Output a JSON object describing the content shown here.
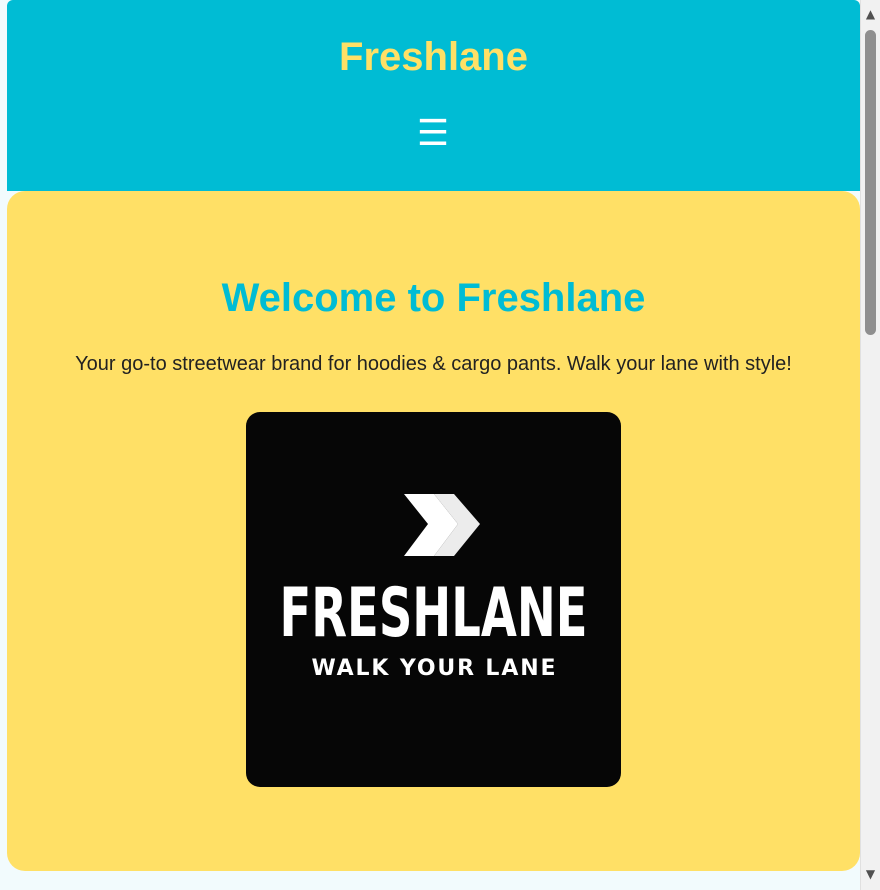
{
  "header": {
    "site_title": "Freshlane",
    "menu_icon": "hamburger-menu-icon",
    "menu_glyph": "☰"
  },
  "hero": {
    "heading": "Welcome to Freshlane",
    "tagline": "Your go-to streetwear brand for hoodies & cargo pants. Walk your lane with style!"
  },
  "logo": {
    "wordmark": "FRESHLANE",
    "slogan": "WALK YOUR LANE",
    "icon": "double-chevron-icon"
  },
  "scrollbar": {
    "up_glyph": "▲",
    "down_glyph": "▼"
  },
  "colors": {
    "header_bg": "#00bcd4",
    "title": "#ffe066",
    "hero_bg": "#ffe066",
    "heading": "#00bcd4",
    "logo_bg": "#060606"
  }
}
